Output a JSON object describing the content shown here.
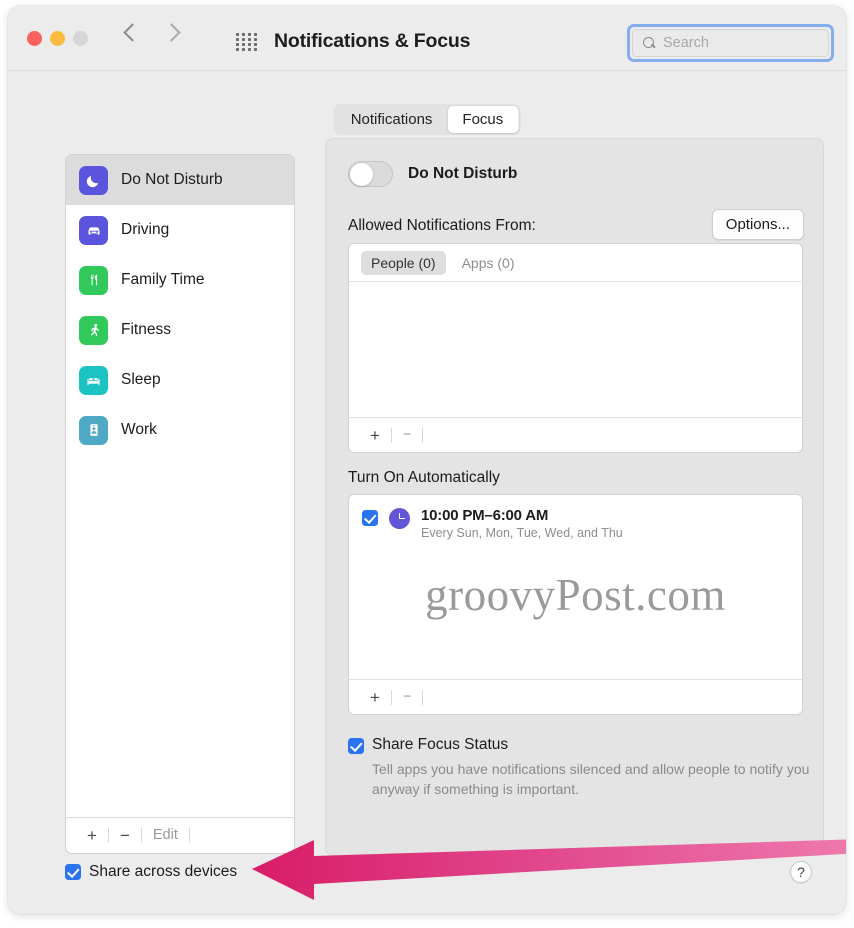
{
  "window": {
    "title": "Notifications & Focus",
    "traffic_lights": [
      "close-red",
      "minimize-yellow",
      "zoom-disabled"
    ],
    "grid_icon": "show-all-grid-icon",
    "back_label": "‹",
    "forward_label": "›"
  },
  "search": {
    "placeholder": "Search",
    "value": "",
    "icon": "search-icon",
    "focus_ring_color": "#86aeef"
  },
  "tabs": [
    {
      "label": "Notifications",
      "active": false
    },
    {
      "label": "Focus",
      "active": true
    }
  ],
  "sidebar": {
    "items": [
      {
        "label": "Do Not Disturb",
        "icon": "moon-icon",
        "color": "#5b55dd",
        "selected": true
      },
      {
        "label": "Driving",
        "icon": "car-icon",
        "color": "#5b55dd",
        "selected": false
      },
      {
        "label": "Family Time",
        "icon": "fork-knife-icon",
        "color": "#31c95a",
        "selected": false
      },
      {
        "label": "Fitness",
        "icon": "running-person-icon",
        "color": "#31c95a",
        "selected": false
      },
      {
        "label": "Sleep",
        "icon": "bed-icon",
        "color": "#1cc3c3",
        "selected": false
      },
      {
        "label": "Work",
        "icon": "id-badge-icon",
        "color": "#4fa8c4",
        "selected": false
      }
    ],
    "toolbar": {
      "add_label": "+",
      "remove_label": "−",
      "edit_label": "Edit"
    },
    "share_across_devices": {
      "label": "Share across devices",
      "checked": true
    }
  },
  "detail": {
    "toggle": {
      "label": "Do Not Disturb",
      "on": false
    },
    "allowed": {
      "heading": "Allowed Notifications From:",
      "options_button": "Options...",
      "tabs": [
        {
          "label": "People (0)",
          "active": true
        },
        {
          "label": "Apps (0)",
          "active": false
        }
      ],
      "toolbar": {
        "add_label": "+",
        "remove_label": "−"
      }
    },
    "turn_on_automatically": {
      "heading": "Turn On Automatically",
      "schedules": [
        {
          "checked": true,
          "icon": "clock-icon",
          "time": "10:00 PM–6:00 AM",
          "days": "Every Sun, Mon, Tue, Wed, and Thu"
        }
      ],
      "toolbar": {
        "add_label": "+",
        "remove_label": "−"
      }
    },
    "share_focus_status": {
      "label": "Share Focus Status",
      "checked": true,
      "description": "Tell apps you have notifications silenced and allow people to notify you anyway if something is important."
    },
    "help_button": "?"
  },
  "watermark": "groovyPost.com",
  "annotation": {
    "arrow_color": "#e0327a",
    "direction": "left",
    "points_to": "Share across devices"
  }
}
